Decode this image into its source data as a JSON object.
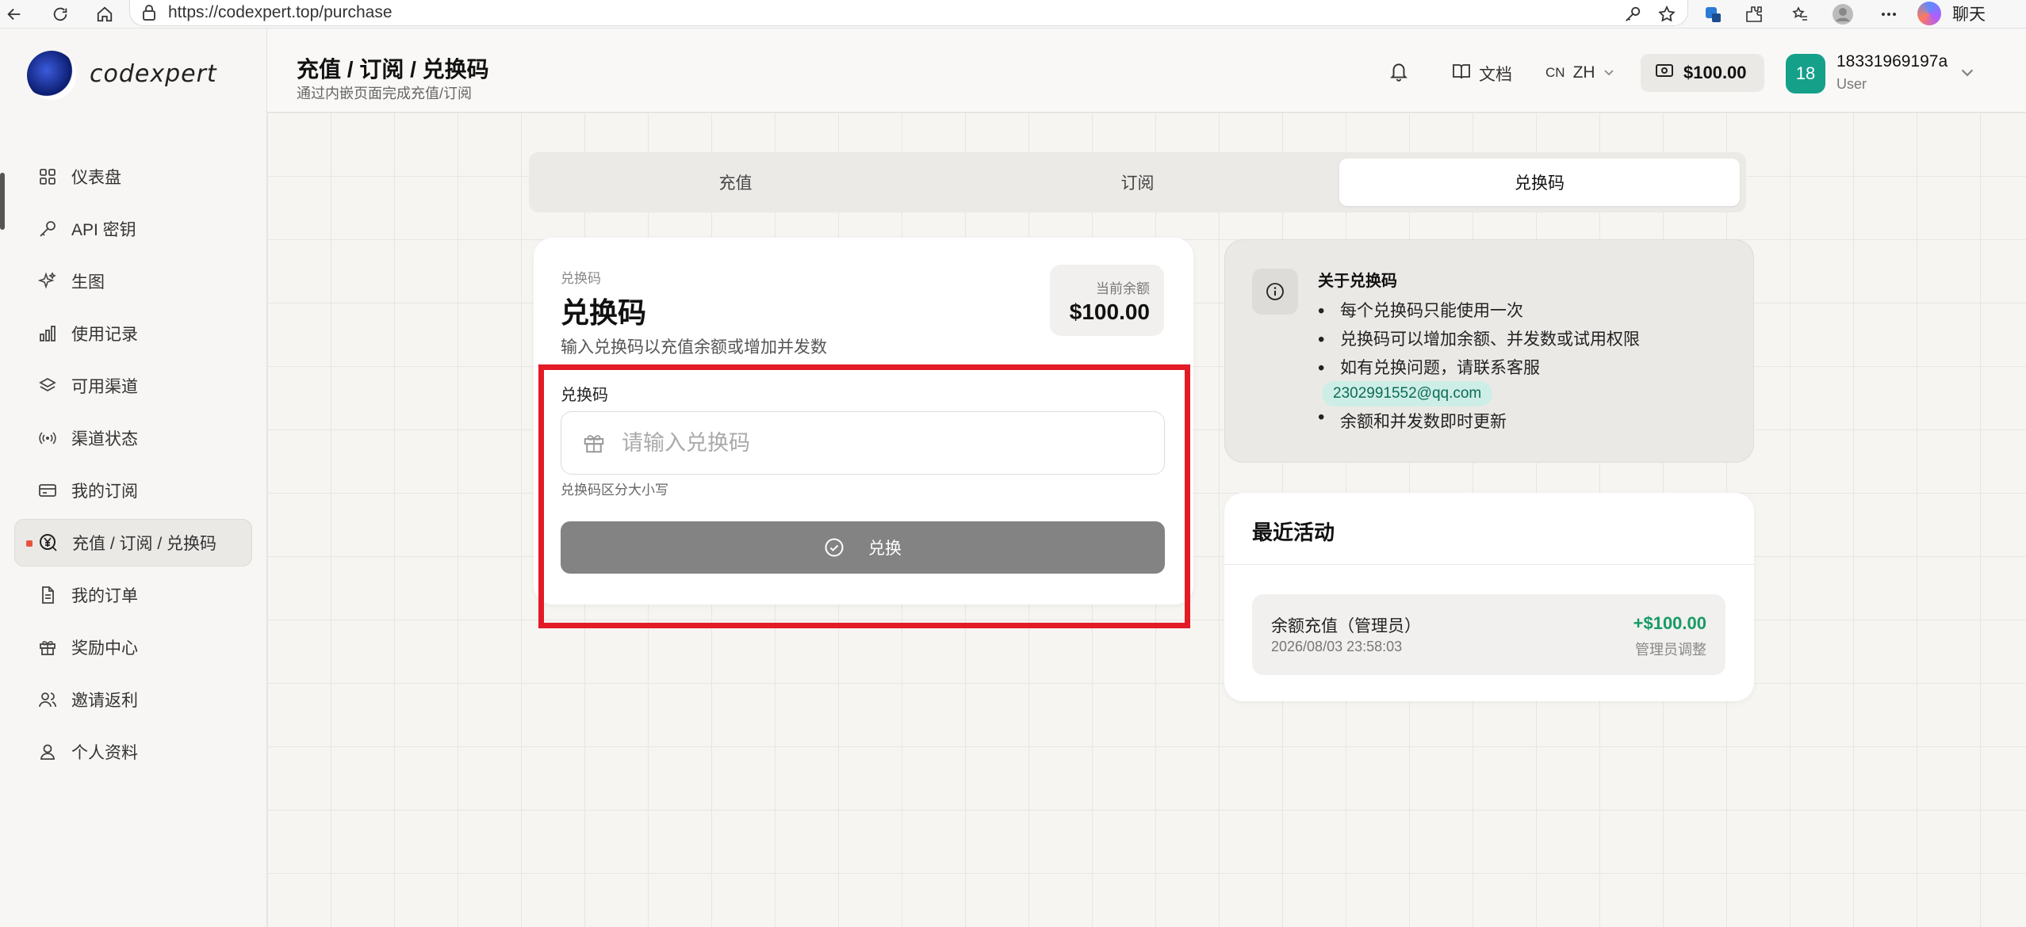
{
  "browser": {
    "url": "https://codexpert.top/purchase",
    "chat_label": "聊天"
  },
  "sidebar": {
    "brand": "codexpert",
    "items": [
      {
        "label": "仪表盘",
        "icon": "dashboard-grid-icon"
      },
      {
        "label": "API 密钥",
        "icon": "key-icon"
      },
      {
        "label": "生图",
        "icon": "sparkle-icon"
      },
      {
        "label": "使用记录",
        "icon": "bar-chart-icon"
      },
      {
        "label": "可用渠道",
        "icon": "layers-icon"
      },
      {
        "label": "渠道状态",
        "icon": "signal-icon"
      },
      {
        "label": "我的订阅",
        "icon": "credit-card-icon"
      },
      {
        "label": "充值 / 订阅 / 兑换码",
        "icon": "yen-search-icon",
        "active": true
      },
      {
        "label": "我的订单",
        "icon": "document-icon"
      },
      {
        "label": "奖励中心",
        "icon": "gift-icon"
      },
      {
        "label": "邀请返利",
        "icon": "users-icon"
      },
      {
        "label": "个人资料",
        "icon": "user-icon"
      }
    ]
  },
  "header": {
    "title": "充值 / 订阅 / 兑换码",
    "subtitle": "通过内嵌页面完成充值/订阅",
    "docs_label": "文档",
    "lang_flag": "CN",
    "lang_label": "ZH",
    "balance": "$100.00",
    "avatar_text": "18",
    "user_name": "18331969197a",
    "user_role": "User"
  },
  "tabs": [
    {
      "label": "充值",
      "active": false
    },
    {
      "label": "订阅",
      "active": false
    },
    {
      "label": "兑换码",
      "active": true
    }
  ],
  "redeem_card": {
    "eyebrow": "兑换码",
    "title": "兑换码",
    "description": "输入兑换码以充值余额或增加并发数",
    "balance_label": "当前余额",
    "balance_value": "$100.00",
    "field_label": "兑换码",
    "input_value": "",
    "input_placeholder": "请输入兑换码",
    "hint": "兑换码区分大小写",
    "button_label": "兑换"
  },
  "info_card": {
    "title": "关于兑换码",
    "items": [
      "每个兑换码只能使用一次",
      "兑换码可以增加余额、并发数或试用权限",
      "如有兑换问题，请联系客服"
    ],
    "email": "2302991552@qq.com",
    "last_item": "余额和并发数即时更新"
  },
  "activity": {
    "title": "最近活动",
    "rows": [
      {
        "name": "余额充值（管理员）",
        "time": "2026/08/03 23:58:03",
        "amount": "+$100.00",
        "note": "管理员调整"
      }
    ]
  },
  "colors": {
    "accent_teal": "#15a08a",
    "highlight_red": "#e21b24",
    "positive_green": "#169b64",
    "button_gray": "#838383"
  }
}
